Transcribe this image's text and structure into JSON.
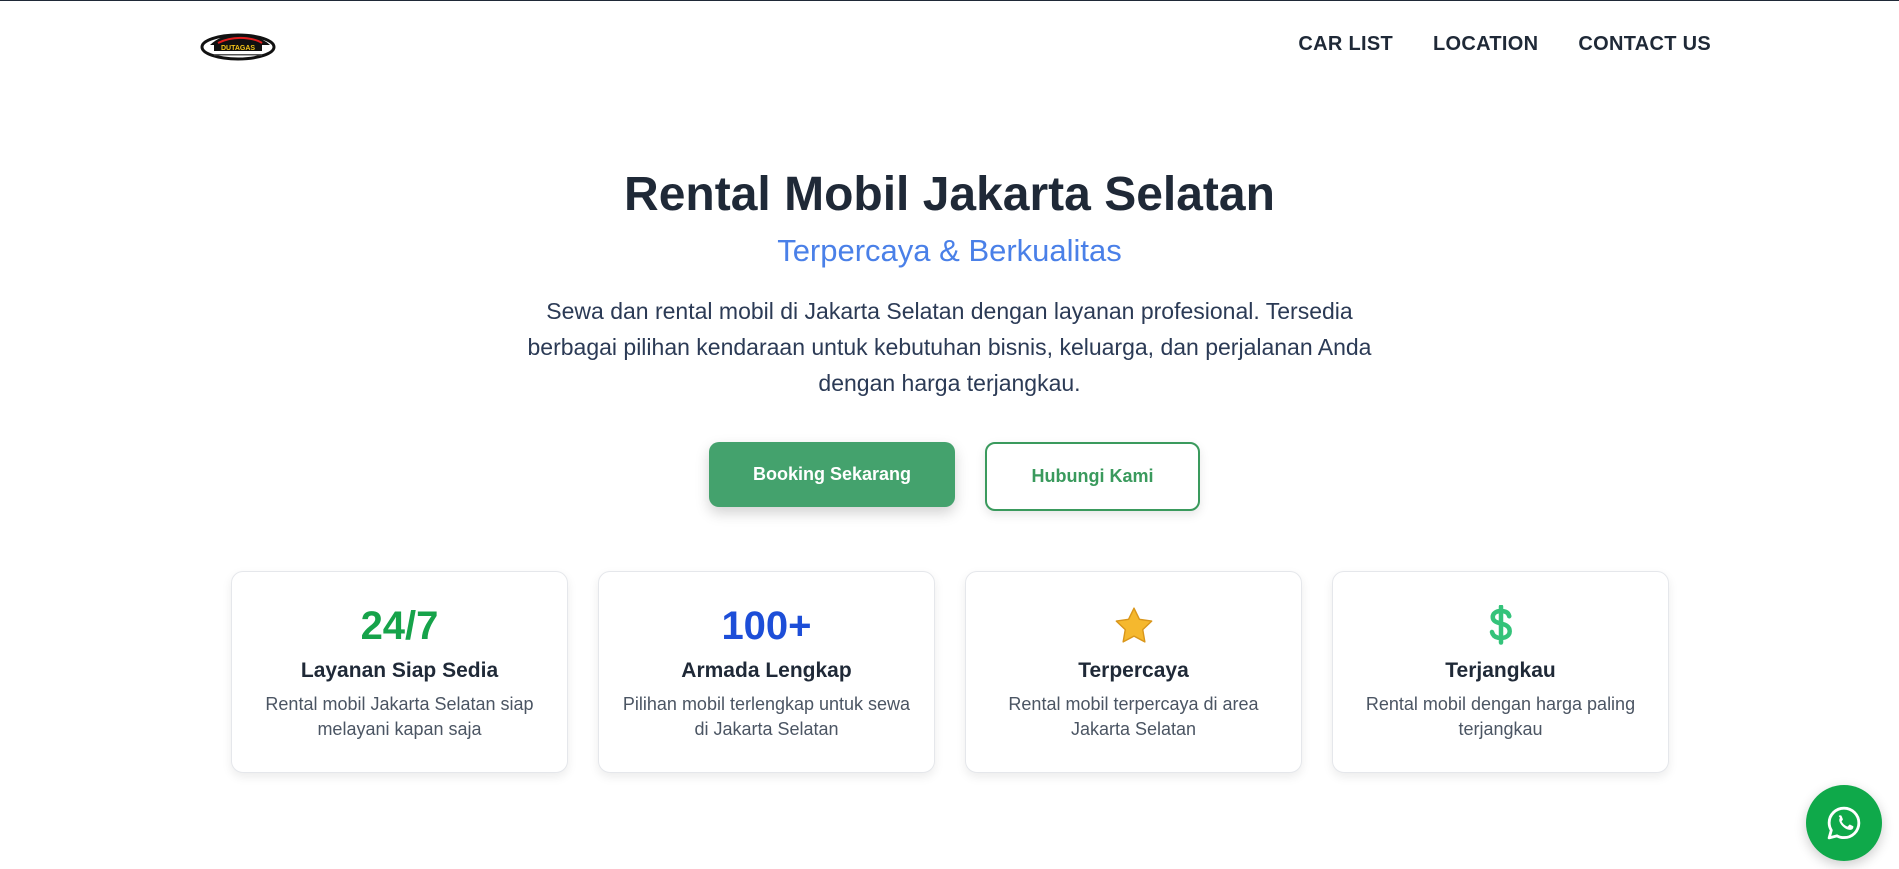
{
  "header": {
    "logo_text": "DUTAGAS",
    "nav": [
      {
        "label": "CAR LIST"
      },
      {
        "label": "LOCATION"
      },
      {
        "label": "CONTACT US"
      }
    ]
  },
  "hero": {
    "title": "Rental Mobil Jakarta Selatan",
    "subtitle": "Terpercaya & Berkualitas",
    "description": "Sewa dan rental mobil di Jakarta Selatan dengan layanan profesional. Tersedia berbagai pilihan kendaraan untuk kebutuhan bisnis, keluarga, dan perjalanan Anda dengan harga terjangkau.",
    "primary_button": "Booking Sekarang",
    "secondary_button": "Hubungi Kami"
  },
  "features": [
    {
      "highlight": "24/7",
      "title": "Layanan Siap Sedia",
      "text": "Rental mobil Jakarta Selatan siap melayani kapan saja"
    },
    {
      "highlight": "100+",
      "title": "Armada Lengkap",
      "text": "Pilihan mobil terlengkap untuk sewa di Jakarta Selatan"
    },
    {
      "icon": "star-icon",
      "title": "Terpercaya",
      "text": "Rental mobil terpercaya di area Jakarta Selatan"
    },
    {
      "icon": "dollar-icon",
      "title": "Terjangkau",
      "text": "Rental mobil dengan harga paling terjangkau"
    }
  ],
  "floating": {
    "icon": "whatsapp-icon"
  },
  "colors": {
    "primary_green": "#44a26d",
    "accent_blue": "#4a80e8",
    "highlight_green": "#16a34a",
    "highlight_blue": "#1d4ed8",
    "whatsapp_green": "#0fa94a"
  }
}
